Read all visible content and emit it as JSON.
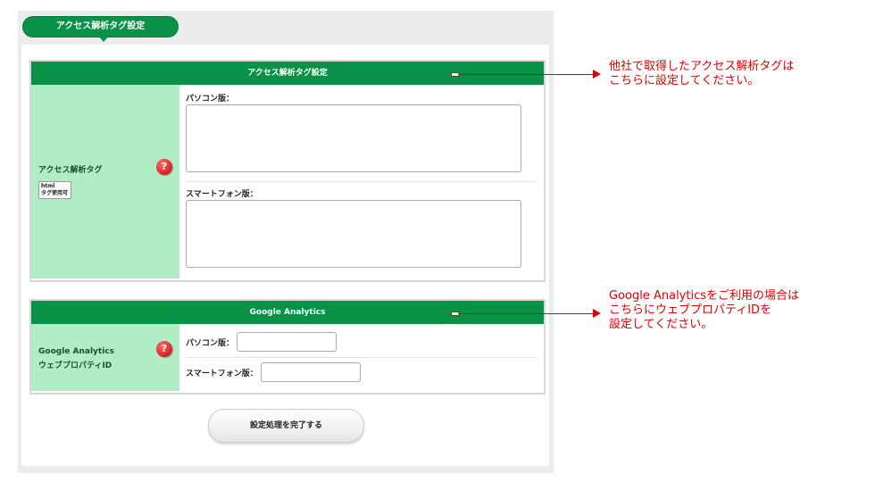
{
  "tab": {
    "label": "アクセス解析タグ設定"
  },
  "section1": {
    "header": "アクセス解析タグ設定",
    "label": "アクセス解析タグ",
    "badge_line1": "html",
    "badge_line2": "タグ使用可",
    "pc_label": "パソコン版：",
    "sp_label": "スマートフォン版："
  },
  "section2": {
    "header": "Google Analytics",
    "label_line1": "Google Analytics",
    "label_line2": "ウェブプロパティID",
    "pc_label": "パソコン版：",
    "sp_label": "スマートフォン版："
  },
  "help_icon_glyph": "?",
  "submit": {
    "label": "設定処理を完了する"
  },
  "annotations": {
    "note1_line1": "他社で取得したアクセス解析タグは",
    "note1_line2": "こちらに設定してください。",
    "note2_line1": "Google Analyticsをご利用の場合は",
    "note2_line2": "こちらにウェブプロパティIDを",
    "note2_line3": "設定してください。"
  },
  "colors": {
    "brand_green": "#0a9148",
    "label_bg": "#b2ecc4",
    "annotation_red": "#e00000"
  }
}
